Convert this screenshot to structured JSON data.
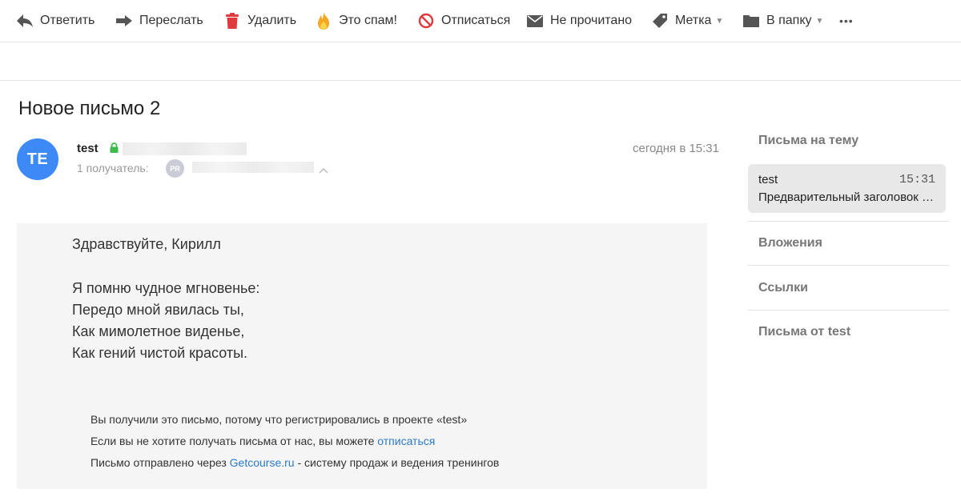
{
  "toolbar": {
    "reply": "Ответить",
    "forward": "Переслать",
    "delete": "Удалить",
    "spam": "Это спам!",
    "unsubscribe": "Отписаться",
    "unread": "Не прочитано",
    "label": "Метка",
    "move": "В папку",
    "more": "•••"
  },
  "message": {
    "subject": "Новое письмо 2",
    "avatar_initials": "TE",
    "sender": "test",
    "recipients_label": "1 получатель:",
    "recipient_badge": "PR",
    "date": "сегодня в 15:31",
    "greeting": "Здравствуйте, Кирилл",
    "poem": [
      "Я помню чудное мгновенье:",
      "Передо мной явилась ты,",
      "Как мимолетное виденье,",
      "Как гений чистой красоты."
    ],
    "footer": {
      "line1": "Вы получили это письмо, потому что регистрировались в проекте «test»",
      "line2_prefix": "Если вы не хотите получать письма от нас, вы можете ",
      "line2_link": "отписаться",
      "line3_prefix": "Письмо отправлено через ",
      "line3_link": "Getcourse.ru",
      "line3_suffix": " - систему продаж и ведения тренингов"
    }
  },
  "sidebar": {
    "thread_heading": "Письма на тему",
    "thread": {
      "name": "test",
      "time": "15:31",
      "preview": "Предварительный заголовок письма"
    },
    "attachments": "Вложения",
    "links": "Ссылки",
    "from_sender": "Письма от test"
  },
  "colors": {
    "avatar": "#3d8af7",
    "link": "#2d7ac6",
    "delete_icon": "#e0393e",
    "spam_icon": "#f5a623",
    "unsubscribe_icon": "#e0393e",
    "lock_icon": "#3dbb4f"
  }
}
